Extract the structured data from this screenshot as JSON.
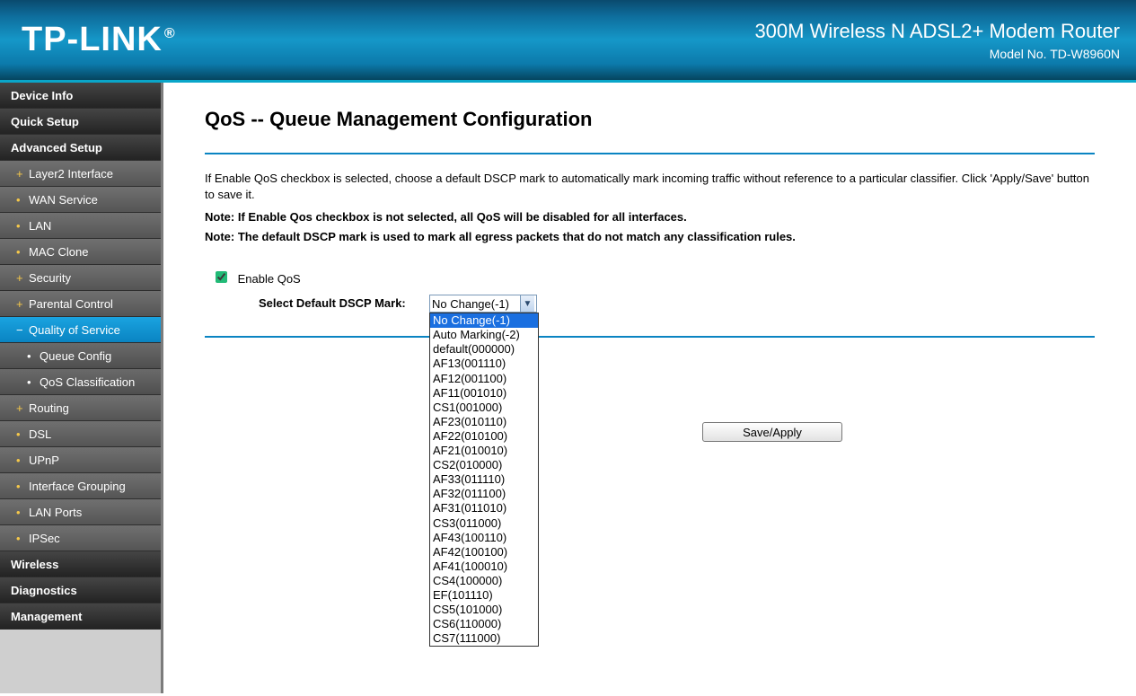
{
  "header": {
    "logo_text": "TP-LINK",
    "logo_reg": "®",
    "product": "300M Wireless N ADSL2+ Modem Router",
    "model": "Model No. TD-W8960N"
  },
  "sidebar": [
    {
      "label": "Device Info",
      "level": "top"
    },
    {
      "label": "Quick Setup",
      "level": "top"
    },
    {
      "label": "Advanced Setup",
      "level": "top"
    },
    {
      "label": "Layer2 Interface",
      "level": "sub",
      "bullet": "+"
    },
    {
      "label": "WAN Service",
      "level": "sub",
      "bullet": "•"
    },
    {
      "label": "LAN",
      "level": "sub",
      "bullet": "•"
    },
    {
      "label": "MAC Clone",
      "level": "sub",
      "bullet": "•"
    },
    {
      "label": "Security",
      "level": "sub",
      "bullet": "+"
    },
    {
      "label": "Parental Control",
      "level": "sub",
      "bullet": "+"
    },
    {
      "label": "Quality of Service",
      "level": "sub",
      "bullet": "−",
      "active": true
    },
    {
      "label": "Queue Config",
      "level": "sub2",
      "bullet": "•"
    },
    {
      "label": "QoS Classification",
      "level": "sub2",
      "bullet": "•"
    },
    {
      "label": "Routing",
      "level": "sub",
      "bullet": "+"
    },
    {
      "label": "DSL",
      "level": "sub",
      "bullet": "•"
    },
    {
      "label": "UPnP",
      "level": "sub",
      "bullet": "•"
    },
    {
      "label": "Interface Grouping",
      "level": "sub",
      "bullet": "•"
    },
    {
      "label": "LAN Ports",
      "level": "sub",
      "bullet": "•"
    },
    {
      "label": "IPSec",
      "level": "sub",
      "bullet": "•"
    },
    {
      "label": "Wireless",
      "level": "top"
    },
    {
      "label": "Diagnostics",
      "level": "top"
    },
    {
      "label": "Management",
      "level": "top"
    }
  ],
  "main": {
    "title": "QoS -- Queue Management Configuration",
    "desc": "If Enable QoS checkbox is selected, choose a default DSCP mark to automatically mark incoming traffic without reference to a particular classifier. Click 'Apply/Save' button to save it.",
    "note1": "Note: If Enable Qos checkbox is not selected, all QoS will be disabled for all interfaces.",
    "note2": "Note: The default DSCP mark is used to mark all egress packets that do not match any classification rules.",
    "enable_label": "Enable QoS",
    "enable_checked": true,
    "dscp_label": "Select Default DSCP Mark:",
    "dscp_selected": "No Change(-1)",
    "dscp_options": [
      "No Change(-1)",
      "Auto Marking(-2)",
      "default(000000)",
      "AF13(001110)",
      "AF12(001100)",
      "AF11(001010)",
      "CS1(001000)",
      "AF23(010110)",
      "AF22(010100)",
      "AF21(010010)",
      "CS2(010000)",
      "AF33(011110)",
      "AF32(011100)",
      "AF31(011010)",
      "CS3(011000)",
      "AF43(100110)",
      "AF42(100100)",
      "AF41(100010)",
      "CS4(100000)",
      "EF(101110)",
      "CS5(101000)",
      "CS6(110000)",
      "CS7(111000)"
    ],
    "apply_label": "Save/Apply"
  }
}
